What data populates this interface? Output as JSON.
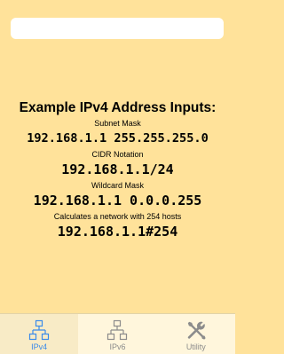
{
  "search": {
    "value": "",
    "placeholder": ""
  },
  "examples": {
    "title": "Example IPv4 Address Inputs:",
    "items": [
      {
        "caption": "Subnet Mask",
        "value": "192.168.1.1 255.255.255.0"
      },
      {
        "caption": "CIDR Notation",
        "value": "192.168.1.1/24"
      },
      {
        "caption": "Wildcard Mask",
        "value": "192.168.1.1 0.0.0.255"
      },
      {
        "caption": "Calculates a network with 254 hosts",
        "value": "192.168.1.1#254"
      }
    ]
  },
  "tabs": [
    {
      "label": "IPv4",
      "icon": "network-icon",
      "active": true
    },
    {
      "label": "IPv6",
      "icon": "network-icon",
      "active": false
    },
    {
      "label": "Utility",
      "icon": "tools-icon",
      "active": false
    }
  ],
  "colors": {
    "background": "#FFE29A",
    "tab_active": "#3B8BEA",
    "tab_inactive": "#8C8C8C"
  }
}
